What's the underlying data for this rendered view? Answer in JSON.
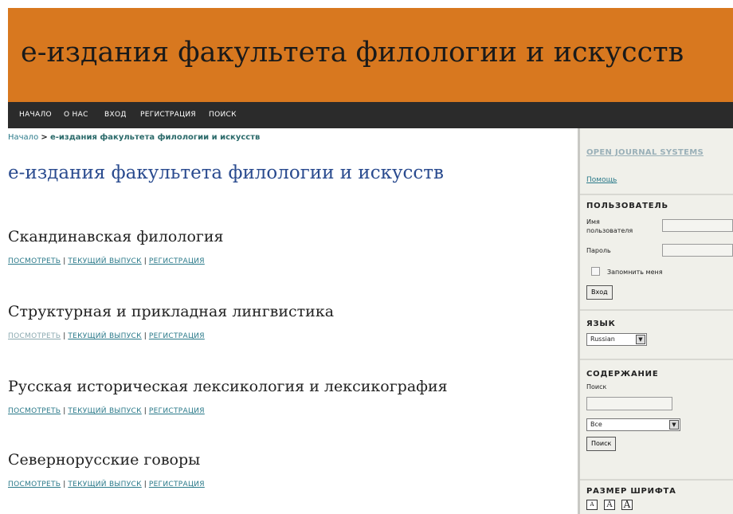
{
  "site": {
    "title": "е-издания факультета филологии и искусств"
  },
  "nav": [
    {
      "label": "НАЧАЛО"
    },
    {
      "label": "О НАС"
    },
    {
      "label": "ВХОД"
    },
    {
      "label": "РЕГИСТРАЦИЯ"
    },
    {
      "label": "ПОИСК"
    }
  ],
  "breadcrumb": {
    "home": "Начало",
    "separator": ">",
    "current": "е-издания факультета филологии и искусств"
  },
  "page": {
    "heading": "е-издания факультета филологии и искусств"
  },
  "journals": [
    {
      "title": "Скандинавская филология",
      "view": "ПОСМОТРЕТЬ",
      "current": "ТЕКУЩИЙ ВЫПУСК",
      "register": "РЕГИСТРАЦИЯ"
    },
    {
      "title": "Структурная и прикладная лингвистика",
      "view": "ПОСМОТРЕТЬ",
      "current": "ТЕКУЩИЙ ВЫПУСК",
      "register": "РЕГИСТРАЦИЯ"
    },
    {
      "title": "Русская историческая лексикология и лексикография",
      "view": "ПОСМОТРЕТЬ",
      "current": "ТЕКУЩИЙ ВЫПУСК",
      "register": "РЕГИСТРАЦИЯ"
    },
    {
      "title": "Севернорусские говоры",
      "view": "ПОСМОТРЕТЬ",
      "current": "ТЕКУЩИЙ ВЫПУСК",
      "register": "РЕГИСТРАЦИЯ"
    }
  ],
  "link_separator": "|",
  "sidebar": {
    "ojs": "OPEN JOURNAL SYSTEMS",
    "help": "Помощь",
    "user": {
      "title": "ПОЛЬЗОВАТЕЛЬ",
      "username_label_1": "Имя",
      "username_label_2": "пользователя",
      "password_label": "Пароль",
      "remember": "Запомнить меня",
      "login_button": "Вход"
    },
    "language": {
      "title": "ЯЗЫК",
      "selected": "Russian"
    },
    "content": {
      "title": "СОДЕРЖАНИЕ",
      "search_label": "Поиск",
      "scope_selected": "Все",
      "search_button": "Поиск"
    },
    "font_size": {
      "title": "РАЗМЕР ШРИФТА",
      "buttons": [
        "A",
        "A",
        "A"
      ]
    }
  },
  "colors": {
    "header_bg": "#d8781f",
    "nav_bg": "#2b2b2b",
    "link": "#2b7a8a",
    "heading": "#2a4b8f",
    "sidebar_bg": "#f0f0ea"
  }
}
